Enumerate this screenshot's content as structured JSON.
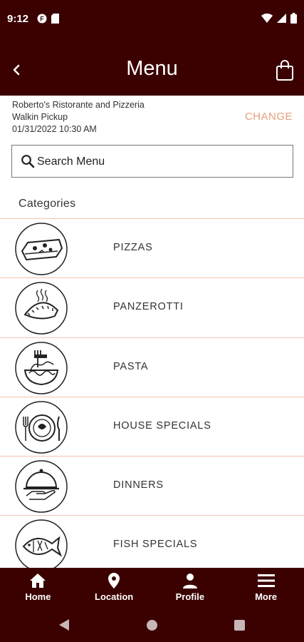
{
  "status_bar": {
    "time": "9:12"
  },
  "header": {
    "title": "Menu"
  },
  "store": {
    "name": "Roberto's Ristorante and Pizzeria",
    "order_type": "Walkin Pickup",
    "datetime": "01/31/2022 10:30 AM",
    "change_label": "CHANGE"
  },
  "search": {
    "placeholder": "Search Menu",
    "value": ""
  },
  "categories_heading": "Categories",
  "categories": [
    {
      "label": "PIZZAS",
      "icon": "pizza-icon"
    },
    {
      "label": "PANZEROTTI",
      "icon": "panzerotti-icon"
    },
    {
      "label": "PASTA",
      "icon": "pasta-icon"
    },
    {
      "label": "HOUSE SPECIALS",
      "icon": "plate-icon"
    },
    {
      "label": "DINNERS",
      "icon": "cloche-icon"
    },
    {
      "label": "FISH SPECIALS",
      "icon": "fish-icon"
    }
  ],
  "bottom_nav": [
    {
      "label": "Home",
      "icon": "home-icon"
    },
    {
      "label": "Location",
      "icon": "location-pin-icon"
    },
    {
      "label": "Profile",
      "icon": "profile-icon"
    },
    {
      "label": "More",
      "icon": "menu-icon"
    }
  ],
  "colors": {
    "brand": "#3b0000",
    "accent": "#e8a07a",
    "divider": "#f2c4ab"
  }
}
